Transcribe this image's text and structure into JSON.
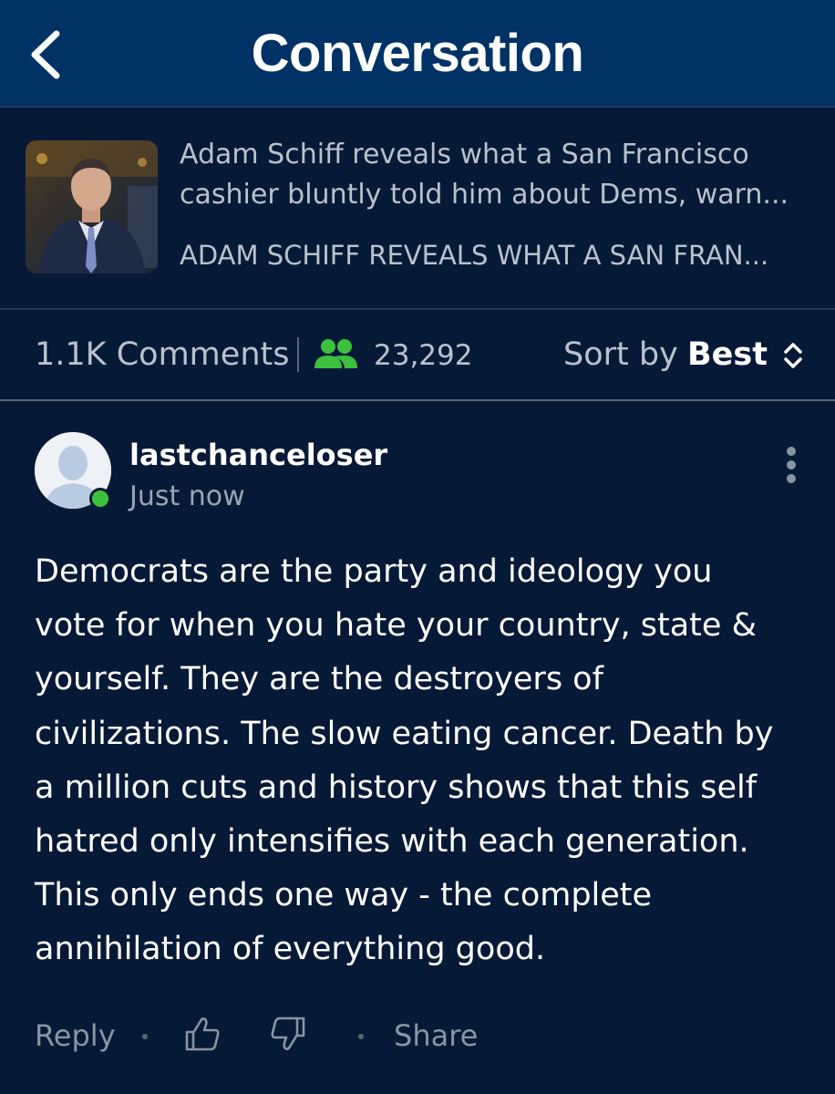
{
  "header": {
    "title": "Conversation",
    "back_icon": "chevron-left-icon",
    "background": "#003266"
  },
  "article": {
    "headline_line1": "Adam Schiff reveals what a San Francisco",
    "headline_line2": "cashier bluntly told him about Dems, warn...",
    "subtitle": "ADAM SCHIFF REVEALS WHAT A SAN FRAN..."
  },
  "meta": {
    "comments_count": "1.1K Comments",
    "viewers_icon": "users-icon",
    "viewers_count": "23,292",
    "viewers_color": "#3dc03d",
    "sort_label": "Sort by",
    "sort_value": "Best",
    "sort_icon": "sort-updown-icon"
  },
  "comment": {
    "username": "lastchanceloser",
    "timestamp": "Just now",
    "online_status_color": "#3dc03d",
    "body": "Democrats are the party and ideology you\nvote for when you hate your country, state &\nyourself. They are the destroyers of\ncivilizations. The slow eating cancer. Death by\na million cuts and history shows that this self\nhatred only intensifies with each generation.\nThis only ends one way - the complete\nannihilation of everything good.",
    "actions": {
      "reply_label": "Reply",
      "upvote_icon": "thumbs-up-icon",
      "downvote_icon": "thumbs-down-icon",
      "share_label": "Share"
    }
  }
}
